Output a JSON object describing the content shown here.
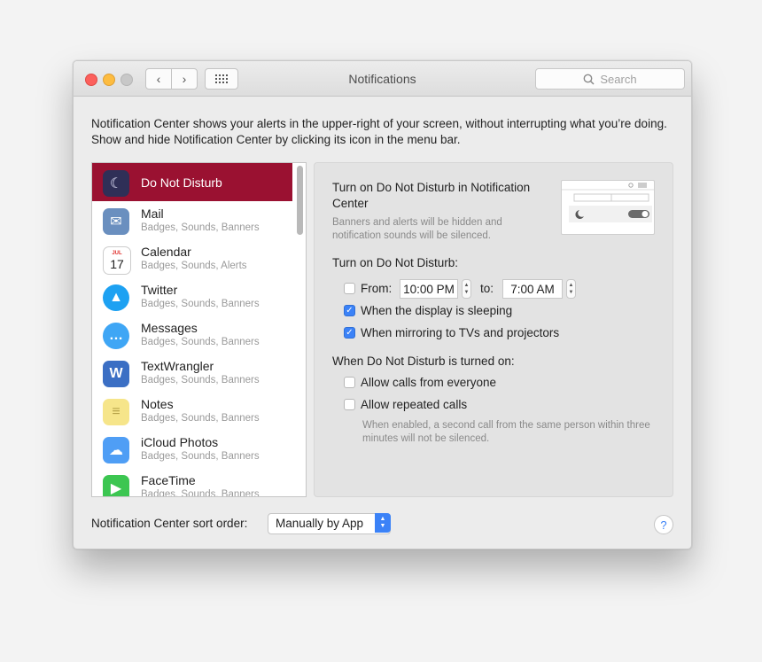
{
  "window": {
    "title": "Notifications"
  },
  "toolbar": {
    "back_icon": "chevron-left-icon",
    "forward_icon": "chevron-right-icon",
    "grid_icon": "grid-icon",
    "search_placeholder": "Search"
  },
  "description": "Notification Center shows your alerts in the upper-right of your screen, without interrupting what you’re doing. Show and hide Notification Center by clicking its icon in the menu bar.",
  "apps": [
    {
      "name": "Do Not Disturb",
      "sub": "",
      "icon": "moon-icon",
      "color": "#2f2f57",
      "selected": true
    },
    {
      "name": "Mail",
      "sub": "Badges, Sounds, Banners",
      "icon": "mail-icon",
      "color": "#6a8fbf"
    },
    {
      "name": "Calendar",
      "sub": "Badges, Sounds, Alerts",
      "icon": "calendar-icon",
      "color": "#ffffff"
    },
    {
      "name": "Twitter",
      "sub": "Badges, Sounds, Banners",
      "icon": "twitter-icon",
      "color": "#1da1f2"
    },
    {
      "name": "Messages",
      "sub": "Badges, Sounds, Banners",
      "icon": "messages-icon",
      "color": "#3fa6f5"
    },
    {
      "name": "TextWrangler",
      "sub": "Badges, Sounds, Banners",
      "icon": "textwrangler-icon",
      "color": "#3b6fc4"
    },
    {
      "name": "Notes",
      "sub": "Badges, Sounds, Banners",
      "icon": "notes-icon",
      "color": "#f6e58a"
    },
    {
      "name": "iCloud Photos",
      "sub": "Badges, Sounds, Banners",
      "icon": "icloud-icon",
      "color": "#4f9ef5"
    },
    {
      "name": "FaceTime",
      "sub": "Badges, Sounds, Banners",
      "icon": "facetime-icon",
      "color": "#3cc651"
    }
  ],
  "calendar_icon": {
    "month": "JUL",
    "day": "17"
  },
  "detail": {
    "heading": "Turn on Do Not Disturb in Notification Center",
    "heading_note": "Banners and alerts will be hidden and notification sounds will be silenced.",
    "schedule_title": "Turn on Do Not Disturb:",
    "from_label": "From:",
    "from_time": "10:00 PM",
    "to_label": "to:",
    "to_time": "7:00 AM",
    "from_checked": false,
    "display_sleeping": "When the display is sleeping",
    "display_sleeping_checked": true,
    "mirroring": "When mirroring to TVs and projectors",
    "mirroring_checked": true,
    "when_on_title": "When Do Not Disturb is turned on:",
    "allow_calls": "Allow calls from everyone",
    "allow_calls_checked": false,
    "allow_repeated": "Allow repeated calls",
    "allow_repeated_checked": false,
    "repeated_note": "When enabled, a second call from the same person within three minutes will not be silenced."
  },
  "footer": {
    "sort_label": "Notification Center sort order:",
    "sort_value": "Manually by App",
    "help": "?"
  }
}
